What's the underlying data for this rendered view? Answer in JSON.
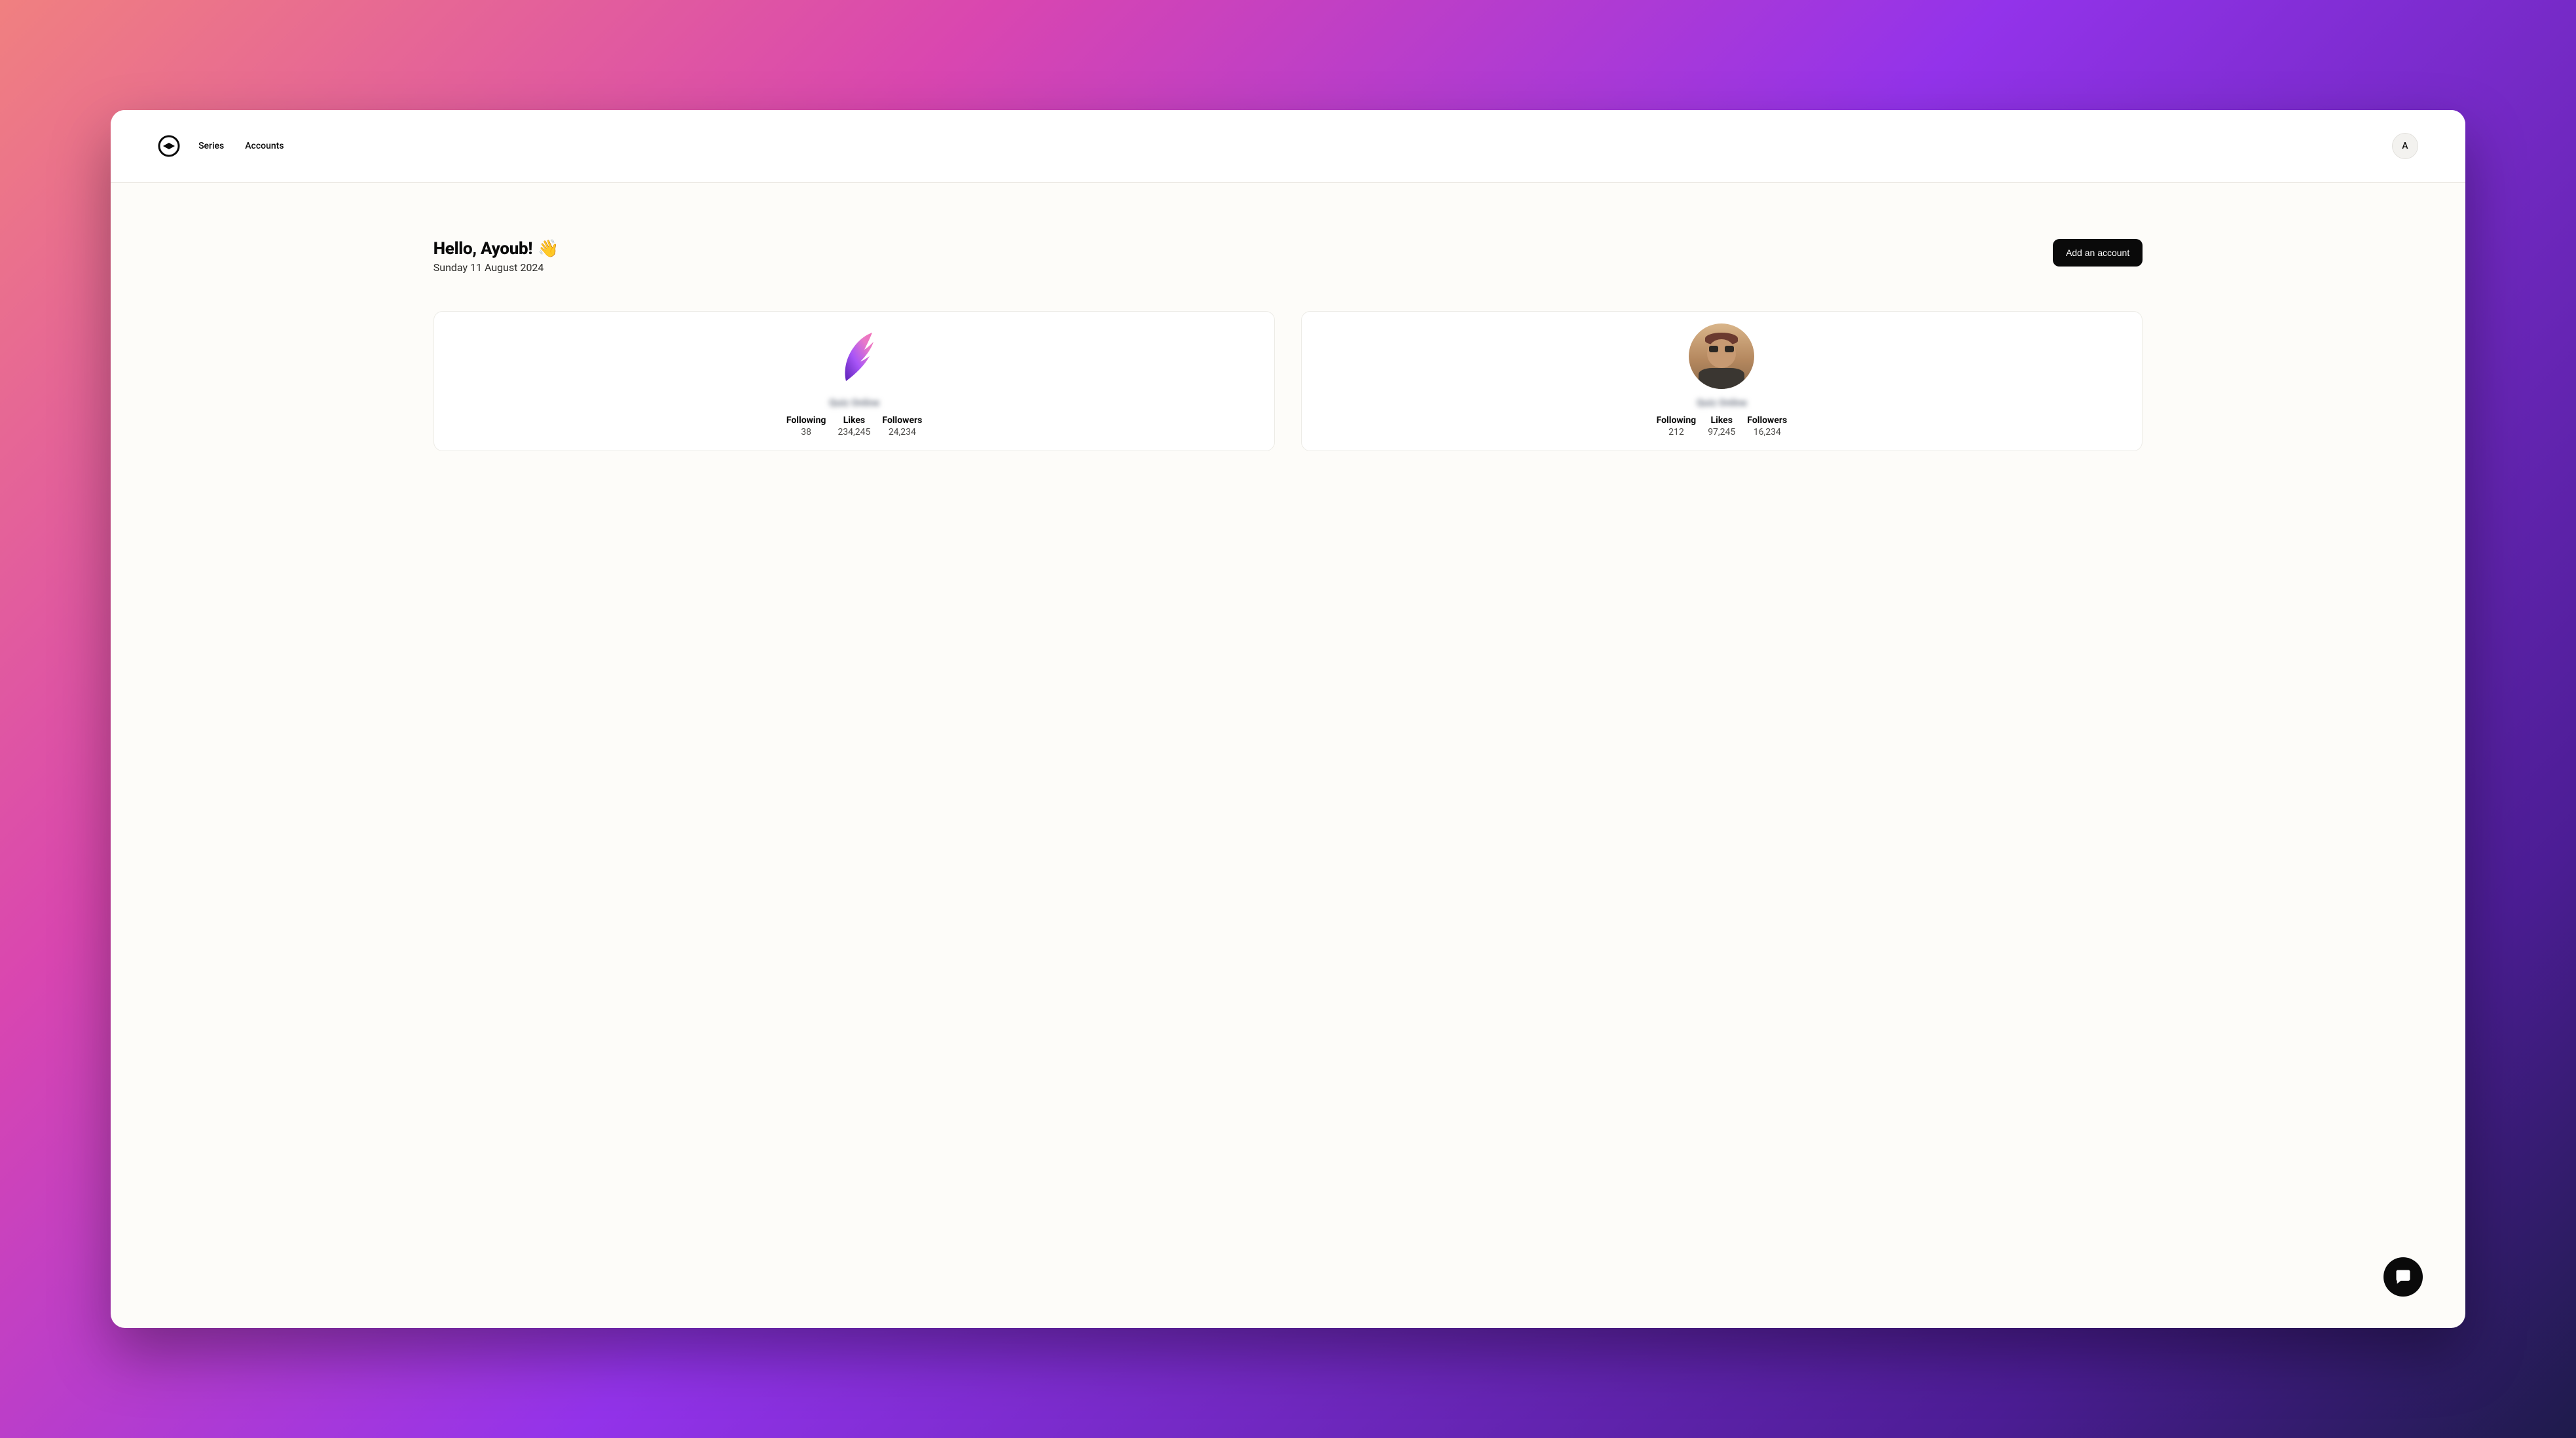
{
  "nav": {
    "items": [
      "Series",
      "Accounts"
    ],
    "avatarInitial": "A"
  },
  "greeting": {
    "title": "Hello, Ayoub!",
    "emoji": "👋",
    "date": "Sunday 11 August 2024"
  },
  "actions": {
    "addAccount": "Add an account"
  },
  "labels": {
    "following": "Following",
    "likes": "Likes",
    "followers": "Followers"
  },
  "accounts": [
    {
      "name": "Quiz Online",
      "avatarType": "feather",
      "following": "38",
      "likes": "234,245",
      "followers": "24,234"
    },
    {
      "name": "Quiz Online",
      "avatarType": "photo",
      "following": "212",
      "likes": "97,245",
      "followers": "16,234"
    }
  ],
  "colors": {
    "primaryButtonBg": "#0a0a0a",
    "primaryButtonText": "#ffffff",
    "windowBg": "#fdfcf9",
    "cardBg": "#ffffff",
    "border": "#ecebe6"
  }
}
